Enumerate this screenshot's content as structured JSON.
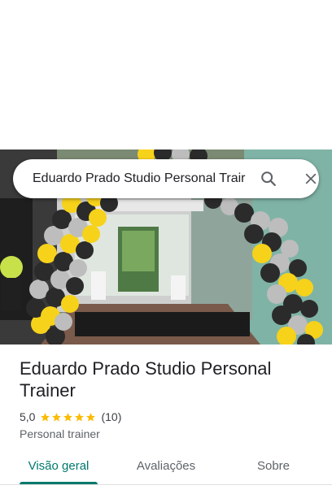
{
  "search": {
    "query": "Eduardo Prado Studio Personal Trair"
  },
  "place": {
    "title": "Eduardo Prado Studio Personal Trainer",
    "rating": "5,0",
    "stars": 5,
    "review_count": "(10)",
    "category": "Personal trainer"
  },
  "tabs": [
    {
      "label": "Visão geral",
      "active": true
    },
    {
      "label": "Avaliações",
      "active": false
    },
    {
      "label": "Sobre",
      "active": false
    }
  ],
  "colors": {
    "accent": "#00796b",
    "star": "#fbbc04",
    "balloon_yellow": "#f7d21a",
    "balloon_black": "#2b2b2b",
    "balloon_grey": "#bdbdbd"
  },
  "icons": {
    "search": "search-icon",
    "close": "close-icon",
    "star": "star-icon"
  }
}
